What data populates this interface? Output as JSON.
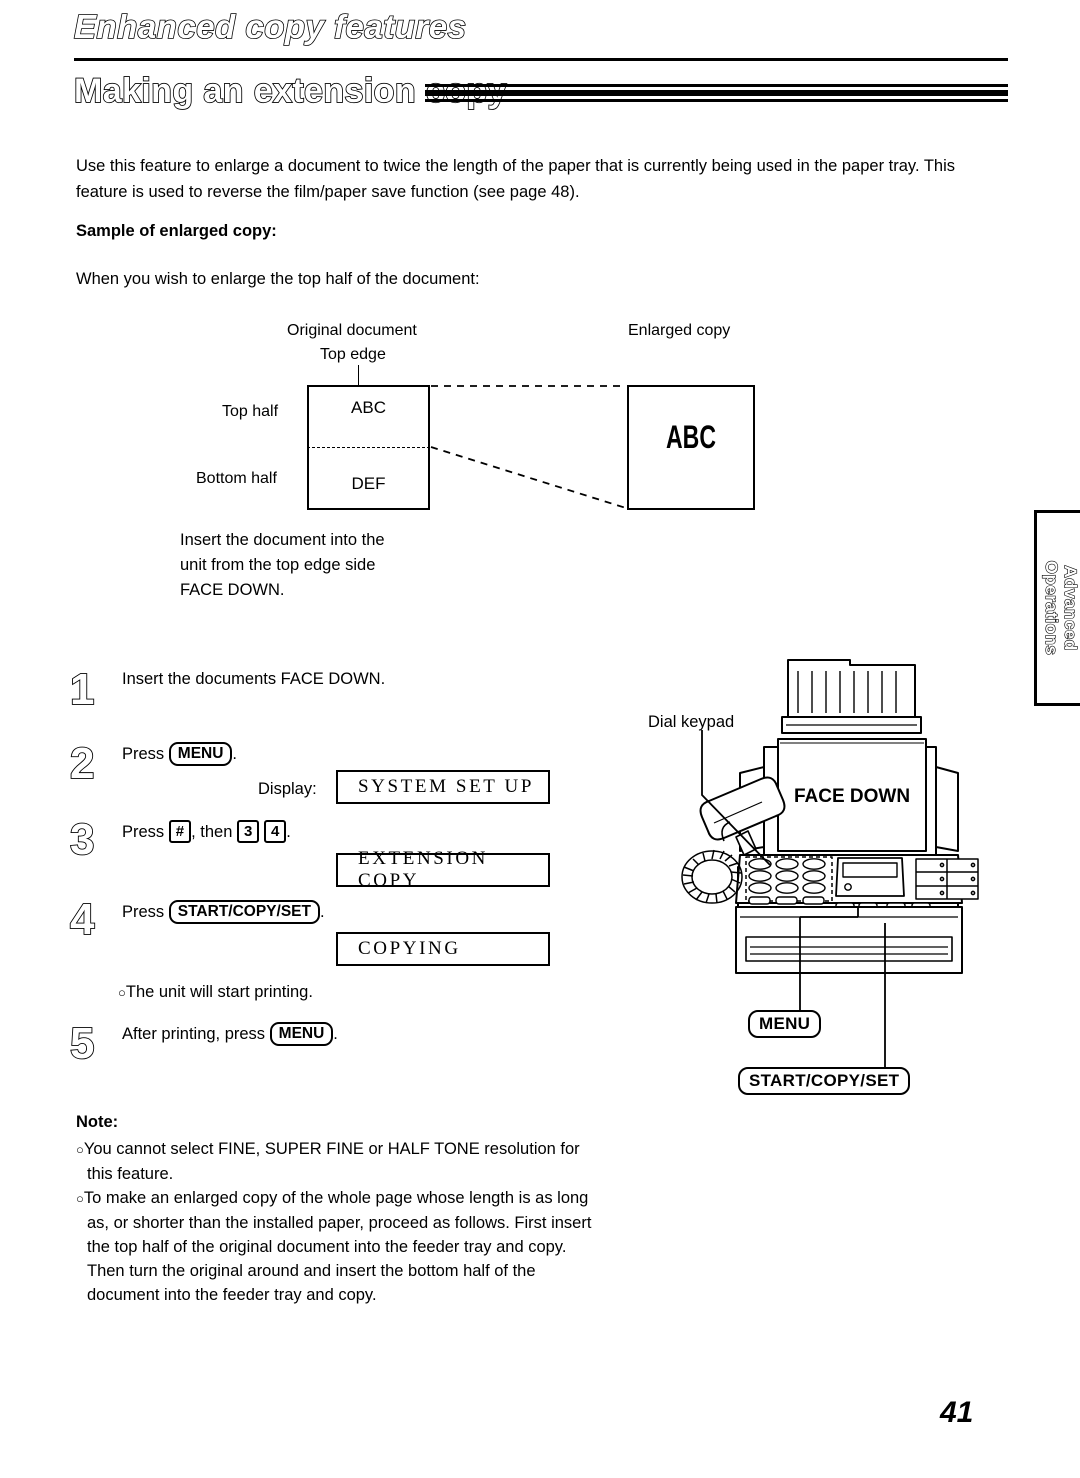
{
  "header": {
    "chapter_title": "Enhanced copy features",
    "section_title": "Making an extension copy"
  },
  "intro": {
    "paragraph": "Use this feature to enlarge a document to twice the length of the paper that is currently being used in the paper tray. This feature is used to reverse the film/paper save function (see page 48).",
    "sample_heading": "Sample of enlarged copy:",
    "wish_line": "When you wish to enlarge the top half of the document:"
  },
  "diagram": {
    "original_document_label": "Original document",
    "top_edge_label": "Top edge",
    "enlarged_copy_label": "Enlarged copy",
    "top_half_label": "Top half",
    "bottom_half_label": "Bottom half",
    "original_top_text": "ABC",
    "original_bottom_text": "DEF",
    "enlarged_text": "ABC",
    "insert_note_line1": "Insert the document into the",
    "insert_note_line2": "unit from the top edge side",
    "insert_note_line3": "FACE DOWN."
  },
  "steps": [
    {
      "number": "1",
      "text": "Insert the documents FACE DOWN."
    },
    {
      "number": "2",
      "text_before": "Press",
      "key": "MENU",
      "text_after": ".",
      "display_label": "Display:",
      "display_value": "SYSTEM SET UP"
    },
    {
      "number": "3",
      "text_before": "Press",
      "key1": "#",
      "text_middle": ", then",
      "key2": "3",
      "key3": "4",
      "text_after": ".",
      "display_value": "EXTENSION COPY"
    },
    {
      "number": "4",
      "text_before": "Press",
      "key": "START/COPY/SET",
      "text_after": ".",
      "display_value": "COPYING",
      "bullet": "The unit will start printing."
    },
    {
      "number": "5",
      "text_before": "After printing, press",
      "key": "MENU",
      "text_after": "."
    }
  ],
  "illustration": {
    "dial_keypad_label": "Dial keypad",
    "face_down_label": "FACE DOWN",
    "menu_callout": "MENU",
    "start_copy_set_callout": "START/COPY/SET"
  },
  "note": {
    "heading": "Note:",
    "items": [
      "You cannot select FINE, SUPER FINE or HALF TONE resolution for this feature.",
      "To make an enlarged copy of the whole page whose length is as long as, or shorter than the installed paper, proceed as follows. First insert the top half of the original document into the feeder tray and copy. Then turn the original around and insert the bottom half of the document into the feeder tray and copy."
    ]
  },
  "side_tab": {
    "line1": "Advanced",
    "line2": "Operations"
  },
  "page_number": "41",
  "colors": {
    "ink": "#000000",
    "paper": "#ffffff"
  }
}
